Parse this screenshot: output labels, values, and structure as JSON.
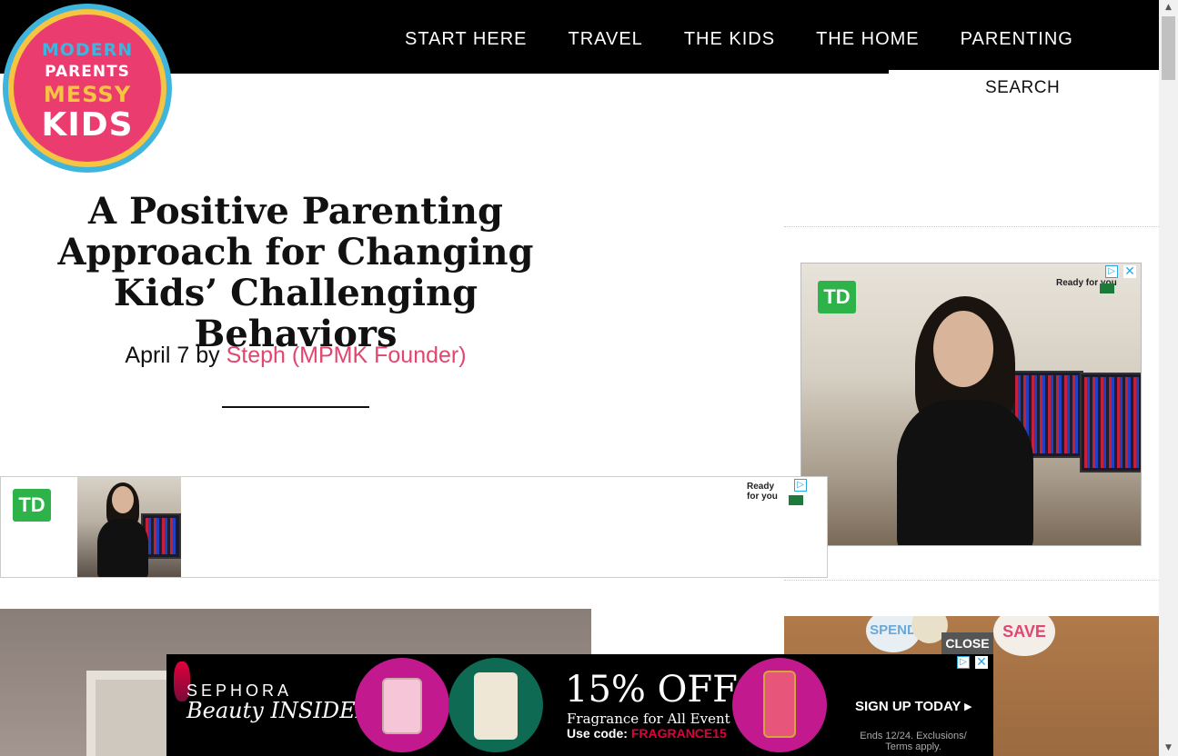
{
  "logo": {
    "line1": "MODERN",
    "line2": "PARENTS",
    "line3": "MESSY",
    "line4": "KIDS"
  },
  "nav": {
    "items": [
      {
        "label": "START HERE"
      },
      {
        "label": "TRAVEL"
      },
      {
        "label": "THE KIDS"
      },
      {
        "label": "THE HOME"
      },
      {
        "label": "PARENTING"
      }
    ],
    "search_label": "SEARCH"
  },
  "article": {
    "title": "A Positive Parenting Approach for Changing Kids’ Challenging Behaviors",
    "date": "April 7",
    "by": " by ",
    "author": "Steph (MPMK Founder)"
  },
  "ads": {
    "td_logo": "TD",
    "td_ready": "Ready\nfor you",
    "adchoices_icon": "adchoices-icon",
    "close_icon": "close-icon",
    "sephora": {
      "brand": "SEPHORA",
      "program": "Beauty INSIDER",
      "discount": "15% OFF",
      "event": "Fragrance for All Event",
      "code_label": "Use code: ",
      "code": "FRAGRANCE15",
      "cta": "SIGN UP TODAY ▸",
      "disclaimer": "Ends 12/24. Exclusions/ Terms apply."
    },
    "close_tab": "CLOSE"
  },
  "jars": {
    "label1": "SPEND",
    "label2": "SAVE"
  },
  "colors": {
    "accent": "#e2466f",
    "td_green": "#2db34a",
    "sephora_red": "#e0003c"
  }
}
